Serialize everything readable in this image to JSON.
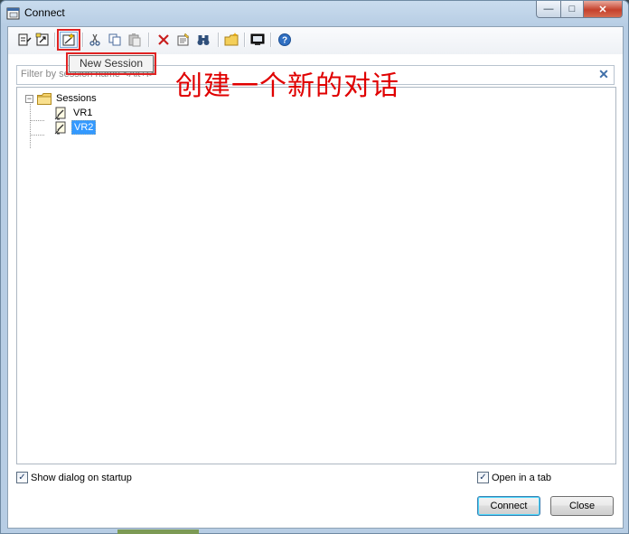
{
  "window": {
    "title": "Connect",
    "min_label": "—",
    "max_label": "□",
    "close_label": "✕"
  },
  "toolbar": {
    "buttons": [
      {
        "name": "quick-connect",
        "icon": "quick-connect-icon"
      },
      {
        "name": "connect-in-tab",
        "icon": "connect-tab-icon"
      },
      {
        "name": "new-session",
        "icon": "new-session-icon"
      },
      {
        "name": "cut",
        "icon": "scissors-icon"
      },
      {
        "name": "copy",
        "icon": "copy-icon"
      },
      {
        "name": "paste",
        "icon": "paste-icon"
      },
      {
        "name": "delete",
        "icon": "delete-icon"
      },
      {
        "name": "properties",
        "icon": "properties-icon"
      },
      {
        "name": "find",
        "icon": "binoculars-icon"
      },
      {
        "name": "new-folder",
        "icon": "new-folder-icon"
      },
      {
        "name": "desktop-shortcut",
        "icon": "monitor-icon"
      },
      {
        "name": "help",
        "icon": "help-icon"
      }
    ],
    "tooltip": "New Session"
  },
  "annotation": "创建一个新的对话",
  "filter": {
    "placeholder": "Filter by session name <Alt+I>",
    "clear_label": "✕"
  },
  "tree": {
    "root": {
      "label": "Sessions",
      "expander": "−"
    },
    "items": [
      {
        "label": "VR1",
        "selected": false
      },
      {
        "label": "VR2",
        "selected": true
      }
    ]
  },
  "footer": {
    "show_on_startup": {
      "label": "Show dialog on startup",
      "checked": true,
      "mark": "✓"
    },
    "open_in_tab": {
      "label": "Open in a tab",
      "checked": true,
      "mark": "✓"
    },
    "connect_label": "Connect",
    "close_label": "Close"
  },
  "colors": {
    "annotation": "#e00000",
    "highlight_box": "#e02222",
    "selection": "#3399ff"
  }
}
